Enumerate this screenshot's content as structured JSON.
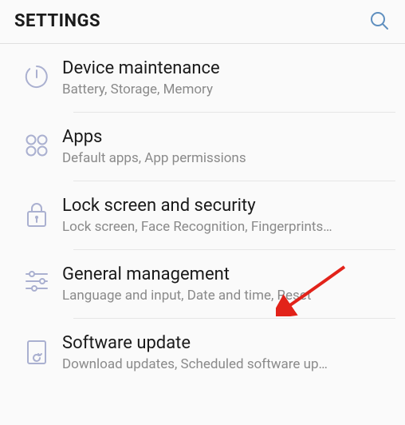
{
  "header": {
    "title": "SETTINGS"
  },
  "items": [
    {
      "title": "Device maintenance",
      "sub": "Battery, Storage, Memory"
    },
    {
      "title": "Apps",
      "sub": "Default apps, App permissions"
    },
    {
      "title": "Lock screen and security",
      "sub": "Lock screen, Face Recognition, Fingerprints…"
    },
    {
      "title": "General management",
      "sub": "Language and input, Date and time, Reset"
    },
    {
      "title": "Software update",
      "sub": "Download updates, Scheduled software up…"
    }
  ],
  "colors": {
    "accent": "#5f8fbf",
    "iconOutline": "#aab0d0"
  }
}
